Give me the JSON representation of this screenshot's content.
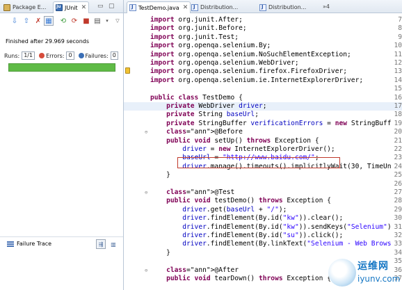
{
  "left": {
    "tabs": [
      {
        "label": "Package E...",
        "icon": "package-explorer-icon"
      },
      {
        "label": "JUnit",
        "icon": "junit-icon"
      }
    ],
    "status": "Finished after 29.969 seconds",
    "runs_label": "Runs:",
    "runs_value": "1/1",
    "errors_label": "Errors:",
    "errors_value": "0",
    "failures_label": "Failures:",
    "failures_value": "0",
    "progress": 1.0,
    "progress_color": "#5fbb46",
    "failure_trace_label": "Failure Trace"
  },
  "right": {
    "tabs": [
      {
        "label": "TestDemo.java"
      },
      {
        "label": "Distribution..."
      },
      {
        "label": "Distribution..."
      }
    ],
    "overflow": "»4",
    "code_lines": [
      {
        "num": "7",
        "text": "import org.junit.After;"
      },
      {
        "num": "8",
        "text": "import org.junit.Before;"
      },
      {
        "num": "9",
        "text": "import org.junit.Test;"
      },
      {
        "num": "10",
        "text": "import org.openqa.selenium.By;"
      },
      {
        "num": "11",
        "text": "import org.openqa.selenium.NoSuchElementException;"
      },
      {
        "num": "12",
        "text": "import org.openqa.selenium.WebDriver;"
      },
      {
        "num": "13",
        "text": "import org.openqa.selenium.firefox.FirefoxDriver;"
      },
      {
        "num": "14",
        "text": "import org.openqa.selenium.ie.InternetExplorerDriver;"
      },
      {
        "num": "15",
        "text": ""
      },
      {
        "num": "16",
        "text": "public class TestDemo {"
      },
      {
        "num": "17",
        "text": "    private WebDriver driver;"
      },
      {
        "num": "18",
        "text": "    private String baseUrl;"
      },
      {
        "num": "19",
        "text": "    private StringBuffer verificationErrors = new StringBuff"
      },
      {
        "num": "20",
        "text": "    @Before"
      },
      {
        "num": "21",
        "text": "    public void setUp() throws Exception {"
      },
      {
        "num": "22",
        "text": "        driver = new InternetExplorerDriver();"
      },
      {
        "num": "23",
        "text": "        baseUrl = \"http://www.baidu.com/\";"
      },
      {
        "num": "24",
        "text": "        driver.manage().timeouts().implicitlyWait(30, TimeUn"
      },
      {
        "num": "25",
        "text": "    }"
      },
      {
        "num": "26",
        "text": ""
      },
      {
        "num": "27",
        "text": "    @Test"
      },
      {
        "num": "28",
        "text": "    public void testDemo() throws Exception {"
      },
      {
        "num": "29",
        "text": "        driver.get(baseUrl + \"/\");"
      },
      {
        "num": "30",
        "text": "        driver.findElement(By.id(\"kw\")).clear();"
      },
      {
        "num": "31",
        "text": "        driver.findElement(By.id(\"kw\")).sendKeys(\"Selenium\")"
      },
      {
        "num": "32",
        "text": "        driver.findElement(By.id(\"su\")).click();"
      },
      {
        "num": "33",
        "text": "        driver.findElement(By.linkText(\"Selenium - Web Brows"
      },
      {
        "num": "34",
        "text": "    }"
      },
      {
        "num": "35",
        "text": ""
      },
      {
        "num": "36",
        "text": "    @After"
      },
      {
        "num": "37",
        "text": "    public void tearDown() throws Exception {"
      }
    ]
  },
  "watermark": {
    "text_cn": "运维网",
    "text_en": "iyunv.com"
  }
}
